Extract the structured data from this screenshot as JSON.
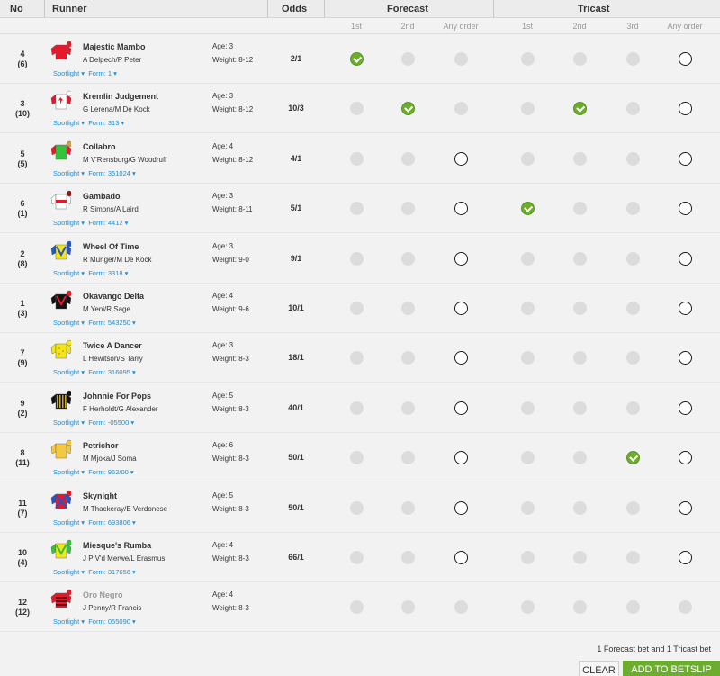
{
  "header": {
    "no": "No",
    "runner": "Runner",
    "odds": "Odds",
    "forecast": "Forecast",
    "tricast": "Tricast"
  },
  "subheader": {
    "forecast": [
      "1st",
      "2nd",
      "Any order"
    ],
    "tricast": [
      "1st",
      "2nd",
      "3rd",
      "Any order"
    ]
  },
  "colors": {
    "selected": "#6dad2e",
    "link": "#1a8fd8",
    "add_button": "#6cad2f"
  },
  "runners": [
    {
      "no": "4",
      "draw": "(6)",
      "name": "Majestic Mambo",
      "faded": false,
      "jockey_trainer": "A Delpech/P Peter",
      "spotlight": "Spotlight ▾",
      "form": "Form: 1 ▾",
      "age": "Age: 3",
      "weight": "Weight: 8-12",
      "odds": "2/1",
      "silk": {
        "body": "#e8182a",
        "sleeve": "#e8182a",
        "cap": "#e8182a",
        "pattern": "plain"
      },
      "selections": [
        "on",
        "off",
        "off",
        "off",
        "off",
        "off",
        "open"
      ]
    },
    {
      "no": "3",
      "draw": "(10)",
      "name": "Kremlin Judgement",
      "faded": false,
      "jockey_trainer": "G Lerena/M De Kock",
      "spotlight": "Spotlight ▾",
      "form": "Form: 313 ▾",
      "age": "Age: 3",
      "weight": "Weight: 8-12",
      "odds": "10/3",
      "silk": {
        "body": "#ffffff",
        "sleeve": "#e8182a",
        "cap": "#ffffff",
        "pattern": "leaf"
      },
      "selections": [
        "off",
        "on",
        "off",
        "off",
        "on",
        "off",
        "open"
      ]
    },
    {
      "no": "5",
      "draw": "(5)",
      "name": "Collabro",
      "faded": false,
      "jockey_trainer": "M V'Rensburg/G Woodruff",
      "spotlight": "Spotlight ▾",
      "form": "Form: 351024 ▾",
      "age": "Age: 4",
      "weight": "Weight: 8-12",
      "odds": "4/1",
      "silk": {
        "body": "#36c13a",
        "sleeve": "#e8182a",
        "cap": "#c7a04a",
        "pattern": "plain"
      },
      "selections": [
        "off",
        "off",
        "open",
        "off",
        "off",
        "off",
        "open"
      ]
    },
    {
      "no": "6",
      "draw": "(1)",
      "name": "Gambado",
      "faded": false,
      "jockey_trainer": "R Simons/A Laird",
      "spotlight": "Spotlight ▾",
      "form": "Form: 4412 ▾",
      "age": "Age: 3",
      "weight": "Weight: 8-11",
      "odds": "5/1",
      "silk": {
        "body": "#ffffff",
        "sleeve": "#ffffff",
        "cap": "#8b1a1a",
        "pattern": "hoop"
      },
      "selections": [
        "off",
        "off",
        "open",
        "on",
        "off",
        "off",
        "open"
      ]
    },
    {
      "no": "2",
      "draw": "(8)",
      "name": "Wheel Of Time",
      "faded": false,
      "jockey_trainer": "R Munger/M De Kock",
      "spotlight": "Spotlight ▾",
      "form": "Form: 3318 ▾",
      "age": "Age: 3",
      "weight": "Weight: 9-0",
      "odds": "9/1",
      "silk": {
        "body": "#f2e51a",
        "sleeve": "#2454c7",
        "cap": "#2454c7",
        "pattern": "chevron"
      },
      "selections": [
        "off",
        "off",
        "open",
        "off",
        "off",
        "off",
        "open"
      ]
    },
    {
      "no": "1",
      "draw": "(3)",
      "name": "Okavango Delta",
      "faded": false,
      "jockey_trainer": "M Yeni/R Sage",
      "spotlight": "Spotlight ▾",
      "form": "Form: 543250 ▾",
      "age": "Age: 4",
      "weight": "Weight: 9-6",
      "odds": "10/1",
      "silk": {
        "body": "#111111",
        "sleeve": "#111111",
        "cap": "#e8182a",
        "pattern": "chevron-red"
      },
      "selections": [
        "off",
        "off",
        "open",
        "off",
        "off",
        "off",
        "open"
      ]
    },
    {
      "no": "7",
      "draw": "(9)",
      "name": "Twice A Dancer",
      "faded": false,
      "jockey_trainer": "L Hewitson/S Tarry",
      "spotlight": "Spotlight ▾",
      "form": "Form: 316095 ▾",
      "age": "Age: 3",
      "weight": "Weight: 8-3",
      "odds": "18/1",
      "silk": {
        "body": "#f2e51a",
        "sleeve": "#f2e51a",
        "cap": "#f2e51a",
        "pattern": "dots"
      },
      "selections": [
        "off",
        "off",
        "open",
        "off",
        "off",
        "off",
        "open"
      ]
    },
    {
      "no": "9",
      "draw": "(2)",
      "name": "Johnnie For Pops",
      "faded": false,
      "jockey_trainer": "F Herholdt/G Alexander",
      "spotlight": "Spotlight ▾",
      "form": "Form: -05500 ▾",
      "age": "Age: 5",
      "weight": "Weight: 8-3",
      "odds": "40/1",
      "silk": {
        "body": "#111111",
        "sleeve": "#111111",
        "cap": "#111111",
        "pattern": "stripes"
      },
      "selections": [
        "off",
        "off",
        "open",
        "off",
        "off",
        "off",
        "open"
      ]
    },
    {
      "no": "8",
      "draw": "(11)",
      "name": "Petrichor",
      "faded": false,
      "jockey_trainer": "M Mjoka/J Soma",
      "spotlight": "Spotlight ▾",
      "form": "Form: 962/00 ▾",
      "age": "Age: 6",
      "weight": "Weight: 8-3",
      "odds": "50/1",
      "silk": {
        "body": "#f5c842",
        "sleeve": "#f5c842",
        "cap": "#f5c842",
        "pattern": "plain"
      },
      "selections": [
        "off",
        "off",
        "open",
        "off",
        "off",
        "on",
        "open"
      ]
    },
    {
      "no": "11",
      "draw": "(7)",
      "name": "Skynight",
      "faded": false,
      "jockey_trainer": "M Thackeray/E Verdonese",
      "spotlight": "Spotlight ▾",
      "form": "Form: 693806 ▾",
      "age": "Age: 5",
      "weight": "Weight: 8-3",
      "odds": "50/1",
      "silk": {
        "body": "#e8182a",
        "sleeve": "#2454c7",
        "cap": "#e8182a",
        "pattern": "cross"
      },
      "selections": [
        "off",
        "off",
        "open",
        "off",
        "off",
        "off",
        "open"
      ]
    },
    {
      "no": "10",
      "draw": "(4)",
      "name": "Miesque's Rumba",
      "faded": false,
      "jockey_trainer": "J P V'd Merwe/L Erasmus",
      "spotlight": "Spotlight ▾",
      "form": "Form: 317656 ▾",
      "age": "Age: 4",
      "weight": "Weight: 8-3",
      "odds": "66/1",
      "silk": {
        "body": "#f2e51a",
        "sleeve": "#36c13a",
        "cap": "#36c13a",
        "pattern": "chevron-green"
      },
      "selections": [
        "off",
        "off",
        "open",
        "off",
        "off",
        "off",
        "open"
      ]
    },
    {
      "no": "12",
      "draw": "(12)",
      "name": "Oro Negro",
      "faded": true,
      "jockey_trainer": "J Penny/R Francis",
      "spotlight": "Spotlight ▾",
      "form": "Form: 055090 ▾",
      "age": "Age: 4",
      "weight": "Weight: 8-3",
      "odds": "",
      "silk": {
        "body": "#e8182a",
        "sleeve": "#e8182a",
        "cap": "#e8182a",
        "pattern": "hoops-black"
      },
      "selections": [
        "off",
        "off",
        "off",
        "off",
        "off",
        "off",
        "off"
      ]
    }
  ],
  "summary": "1 Forecast bet and 1 Tricast bet",
  "buttons": {
    "clear": "CLEAR",
    "add": "ADD TO BETSLIP"
  }
}
